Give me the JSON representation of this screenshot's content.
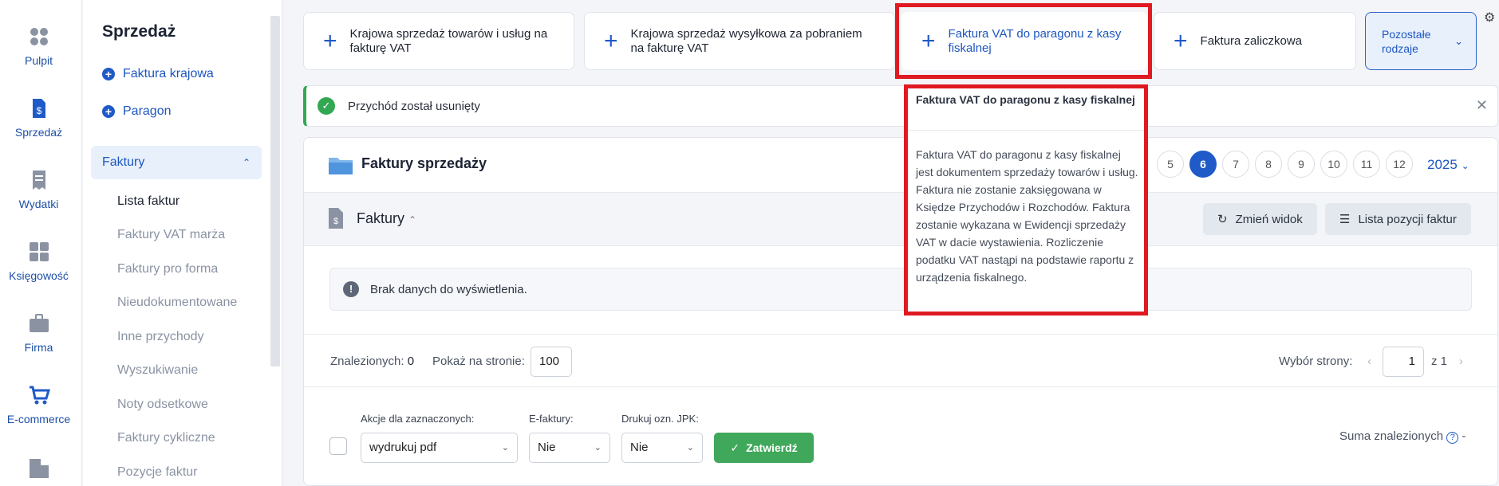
{
  "rail": {
    "items": [
      {
        "label": "Pulpit",
        "icon": "dashboard-icon"
      },
      {
        "label": "Sprzedaż",
        "icon": "invoice-dollar-icon"
      },
      {
        "label": "Wydatki",
        "icon": "receipt-icon"
      },
      {
        "label": "Księgowość",
        "icon": "calculator-icon"
      },
      {
        "label": "Firma",
        "icon": "briefcase-icon"
      },
      {
        "label": "E-commerce",
        "icon": "cart-icon"
      },
      {
        "label": "",
        "icon": "building-icon"
      }
    ]
  },
  "sidebar": {
    "title": "Sprzedaż",
    "links": [
      "Faktura krajowa",
      "Paragon"
    ],
    "group": "Faktury",
    "subitems": [
      "Lista faktur",
      "Faktury VAT marża",
      "Faktury pro forma",
      "Nieudokumentowane",
      "Inne przychody",
      "Wyszukiwanie",
      "Noty odsetkowe",
      "Faktury cykliczne",
      "Pozycje faktur"
    ]
  },
  "tiles": [
    {
      "label": "Krajowa sprzedaż towarów i usług na fakturę VAT"
    },
    {
      "label": "Krajowa sprzedaż wysyłkowa za pobraniem na fakturę VAT"
    },
    {
      "label": "Faktura VAT do paragonu z kasy fiskalnej"
    },
    {
      "label": "Faktura zaliczkowa"
    }
  ],
  "more_types": "Pozostałe rodzaje",
  "alert": {
    "text": "Przychód został usunięty"
  },
  "tooltip": {
    "title": "Faktura VAT do paragonu z kasy fiskalnej",
    "body": "Faktura VAT do paragonu z kasy fiskalnej jest dokumentem sprzedaży towarów i usług. Faktura nie zostanie zaksięgowana w Księdze Przychodów i Rozchodów. Faktura zostanie wykazana w Ewidencji sprzedaży VAT w dacie wystawienia. Rozliczenie podatku VAT nastąpi na podstawie raportu z urządzenia fiskalnego."
  },
  "card": {
    "title": "Faktury sprzedaży",
    "months": [
      "5",
      "6",
      "7",
      "8",
      "9",
      "10",
      "11",
      "12"
    ],
    "active_month": "6",
    "year": "2025",
    "subtitle": "Faktury",
    "change_view": "Zmień widok",
    "positions_list": "Lista pozycji faktur",
    "empty": "Brak danych do wyświetlenia.",
    "found_label": "Znalezionych:",
    "found_value": "0",
    "per_page_label": "Pokaż na stronie:",
    "per_page_value": "100",
    "page_select_label": "Wybór strony:",
    "page_value": "1",
    "page_of": "z",
    "page_total": "1",
    "actions_label": "Akcje dla zaznaczonych:",
    "actions_value": "wydrukuj pdf",
    "einvoice_label": "E-faktury:",
    "einvoice_value": "Nie",
    "jpk_label": "Drukuj ozn. JPK:",
    "jpk_value": "Nie",
    "confirm": "Zatwierdź",
    "sum_label": "Suma znalezionych",
    "sum_value": "-"
  }
}
